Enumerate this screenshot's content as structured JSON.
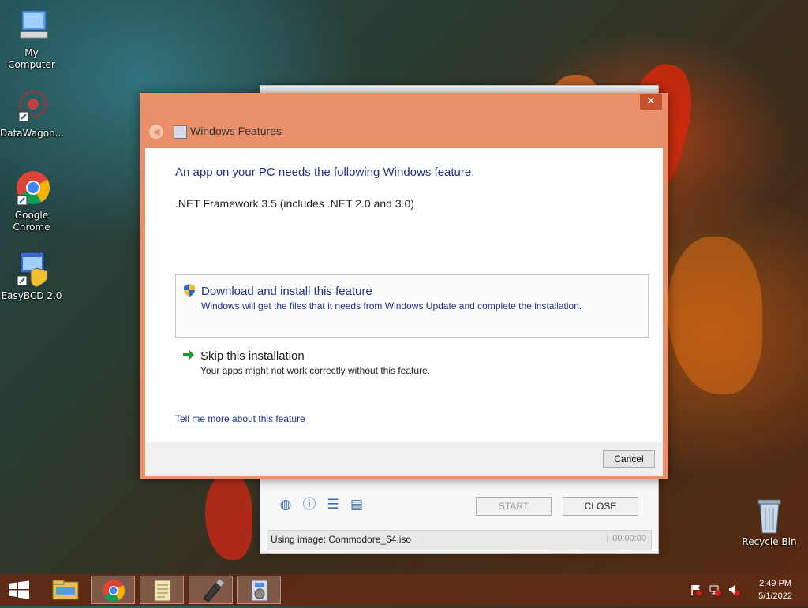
{
  "desktop": {
    "icons": [
      {
        "label": "My Computer"
      },
      {
        "label": "DataWagon..."
      },
      {
        "label": "Google Chrome"
      },
      {
        "label": "EasyBCD 2.0"
      },
      {
        "label": "Recycle Bin"
      }
    ]
  },
  "background_window": {
    "start_label": "START",
    "close_label": "CLOSE",
    "status_text": "Using image: Commodore_64.iso",
    "timer": "00:00:00"
  },
  "dialog": {
    "title": "Windows Features",
    "close_glyph": "✕",
    "heading": "An app on your PC needs the following Windows feature:",
    "feature_name": ".NET Framework 3.5 (includes .NET 2.0 and 3.0)",
    "options": [
      {
        "title": "Download and install this feature",
        "description": "Windows will get the files that it needs from Windows Update and complete the installation.",
        "icon": "shield-icon"
      },
      {
        "title": "Skip this installation",
        "description": "Your apps might not work correctly without this feature.",
        "icon": "green-arrow-icon"
      }
    ],
    "more_link": "Tell me more about this feature",
    "cancel_label": "Cancel",
    "accent_color": "#e9906b"
  },
  "taskbar": {
    "items": [
      "file-explorer-icon",
      "chrome-icon",
      "notepad-icon",
      "usb-drive-icon",
      "setup-app-icon"
    ],
    "time": "2:49 PM",
    "date": "5/1/2022"
  }
}
